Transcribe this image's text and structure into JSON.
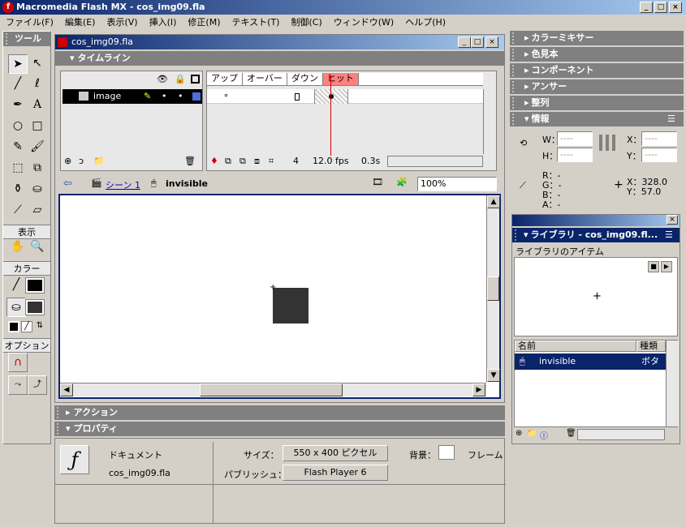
{
  "window": {
    "title": "Macromedia Flash MX - cos_img09.fla",
    "min": "_",
    "max": "□",
    "close": "×"
  },
  "menu": [
    "ファイル(F)",
    "編集(E)",
    "表示(V)",
    "挿入(I)",
    "修正(M)",
    "テキスト(T)",
    "制御(C)",
    "ウィンドウ(W)",
    "ヘルプ(H)"
  ],
  "tools": {
    "header": "ツール",
    "view_label": "表示",
    "color_label": "カラー",
    "options_label": "オプション"
  },
  "doc": {
    "title": "cos_img09.fla",
    "timeline_label": "タイムライン",
    "layer_name": "image",
    "frame_tabs": [
      "アップ",
      "オーバー",
      "ダウン",
      "ヒット"
    ],
    "frame_number": "4",
    "fps": "12.0 fps",
    "time": "0.3s",
    "scene": "シーン 1",
    "symbol": "invisible",
    "zoom": "100%"
  },
  "bottom": {
    "actions_label": "アクション",
    "properties_label": "プロパティ",
    "doc_type": "ドキュメント",
    "doc_name": "cos_img09.fla",
    "size_label": "サイズ：",
    "size_value": "550 x 400 ピクセル",
    "bg_label": "背景：",
    "frame_label": "フレーム",
    "publish_label": "パブリッシュ：",
    "publish_value": "Flash Player 6"
  },
  "right_panels": [
    "カラーミキサー",
    "色見本",
    "コンポーネント",
    "アンサー",
    "整列"
  ],
  "info": {
    "header": "情報",
    "w_label": "W：",
    "h_label": "H：",
    "x_label": "X：",
    "y_label": "Y：",
    "w_val": "----",
    "h_val": "----",
    "x_val": "----",
    "y_val": "----",
    "r": "R：-",
    "g": "G：-",
    "b": "B：-",
    "a": "A：-",
    "cx": "X：328.0",
    "cy": "Y：57.0"
  },
  "library": {
    "header": "ライブラリ - cos_img09.fl...",
    "items_label": "ライブラリのアイテム",
    "col_name": "名前",
    "col_kind": "種類",
    "item_name": "invisible",
    "item_kind": "ボタン"
  },
  "colors": {
    "selection": "#0a246a",
    "hit_tab": "#ff8080",
    "playhead": "#cc0000",
    "stage_square": "#333333"
  }
}
